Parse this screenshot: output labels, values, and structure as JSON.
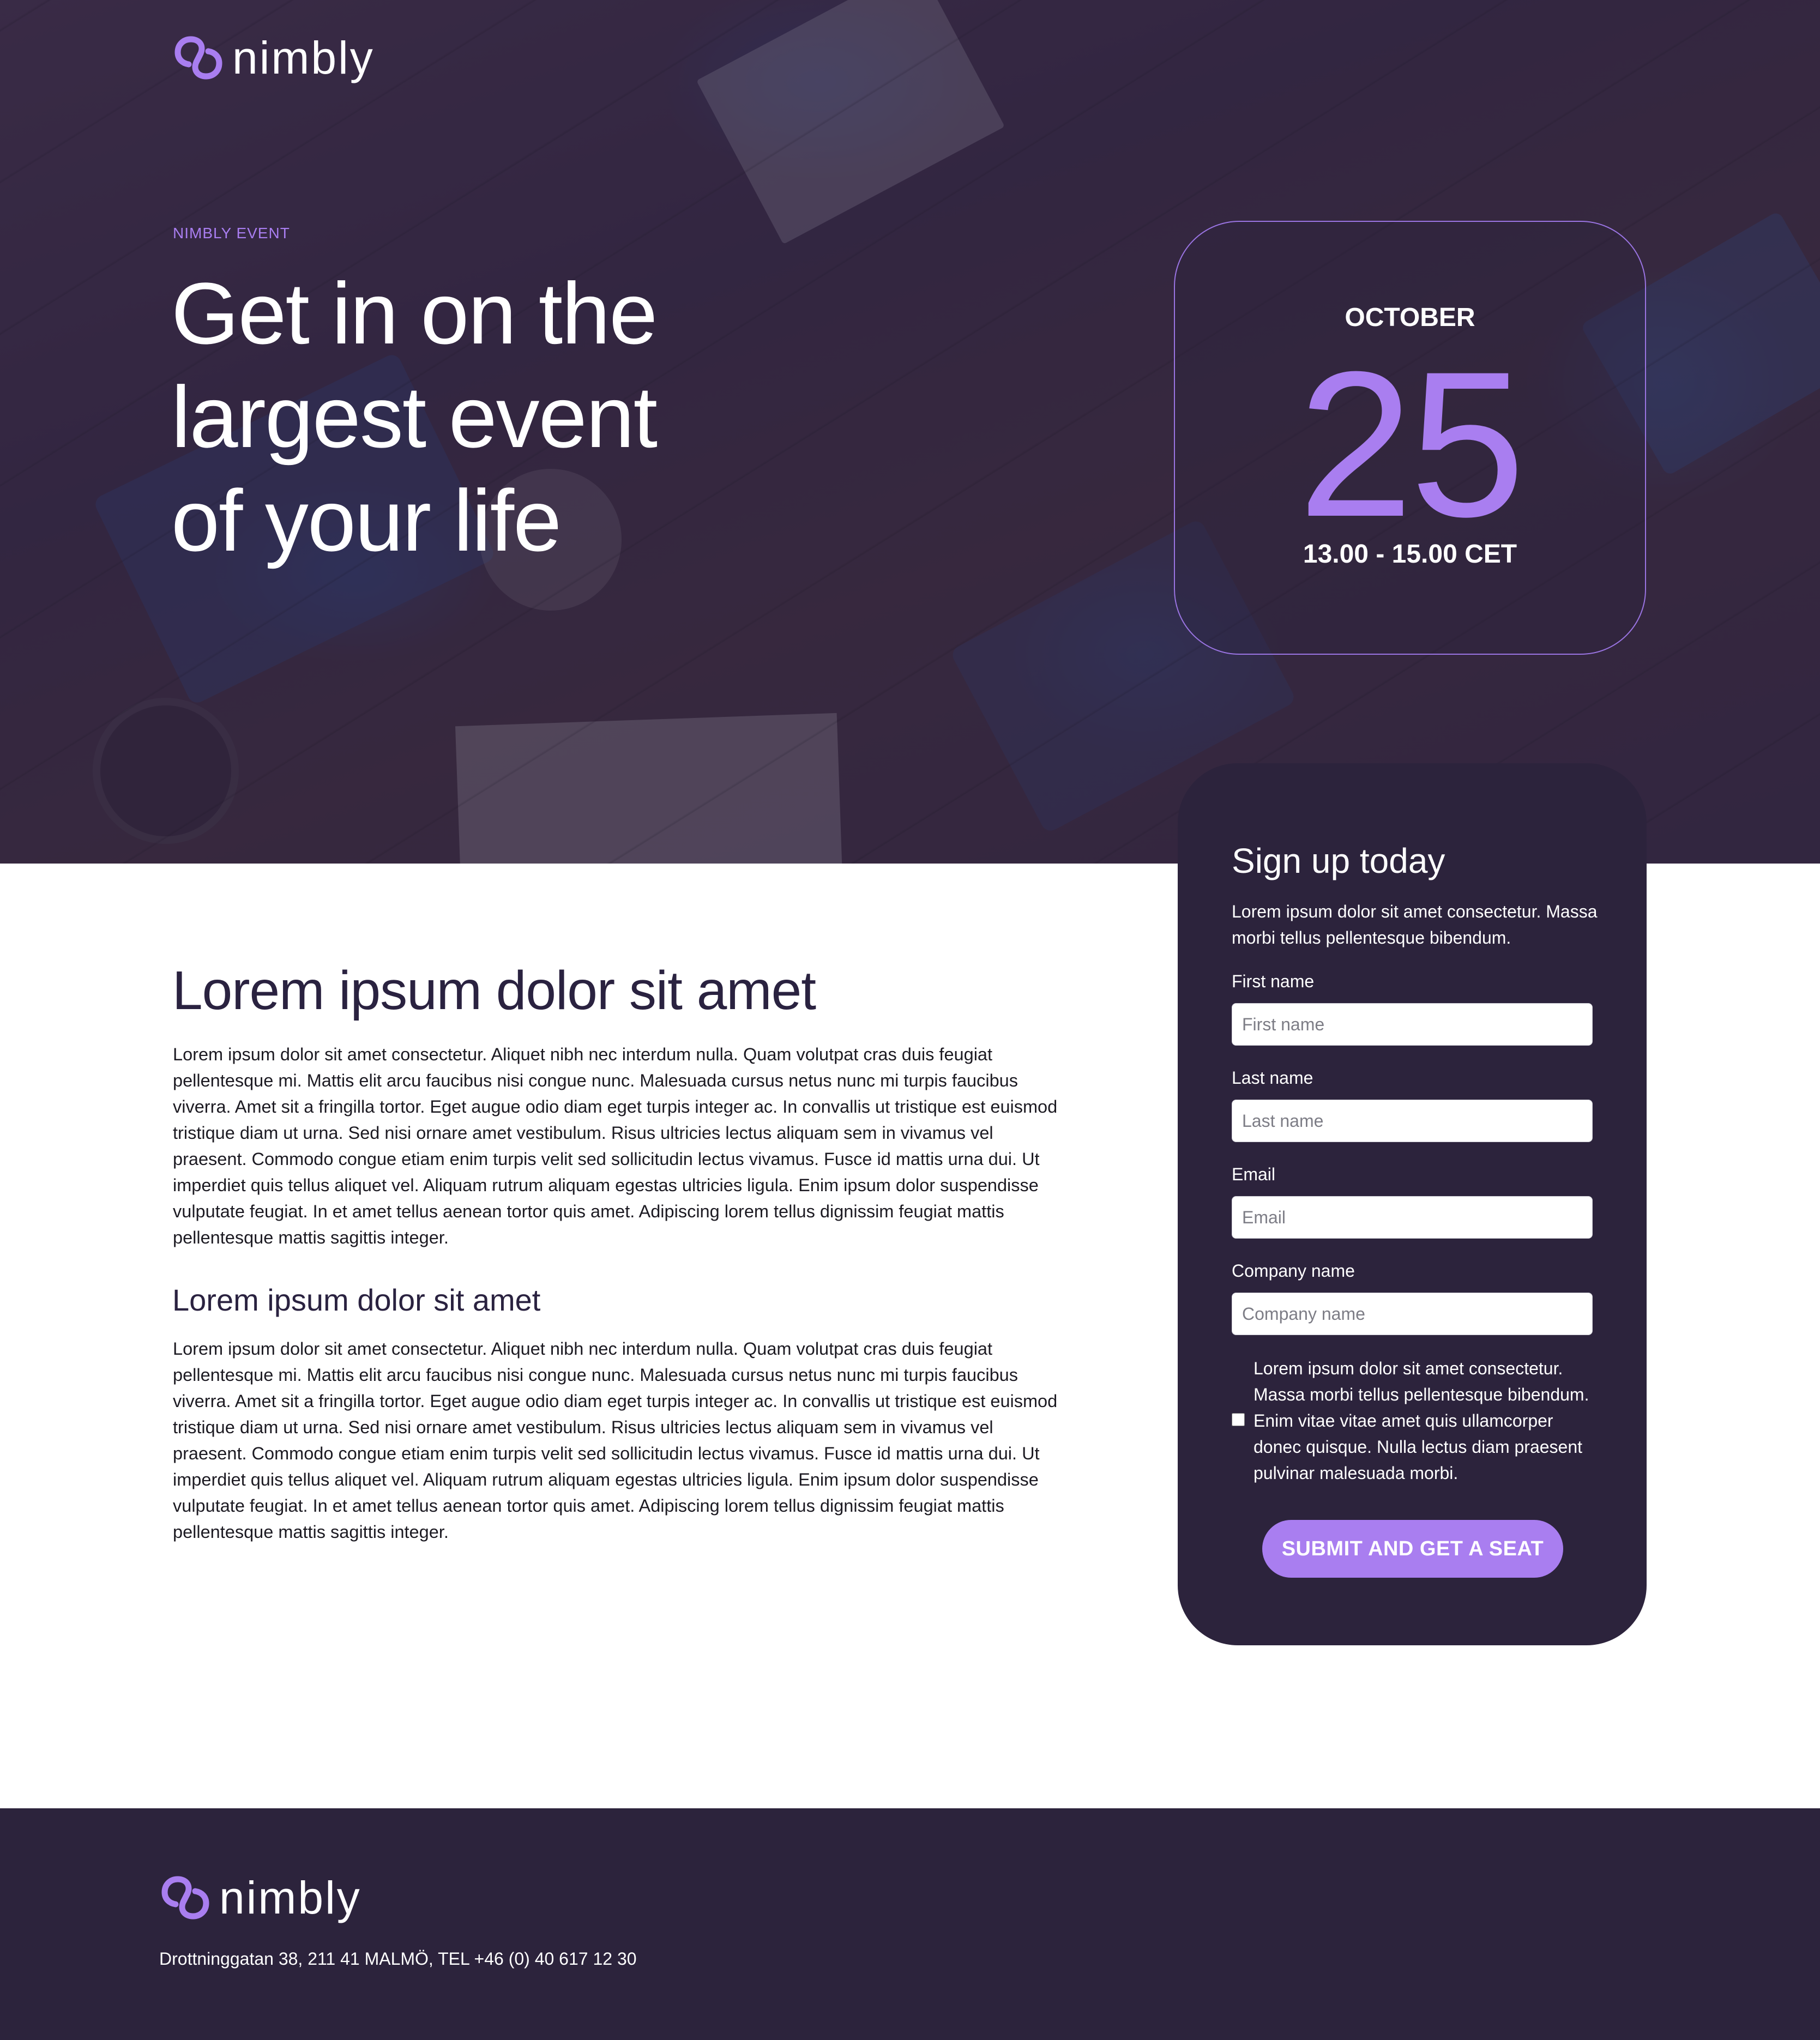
{
  "brand": {
    "name": "nimbly",
    "accent_color": "#a97ef0",
    "dark_color": "#2c233c",
    "logo_icon": "chain-link-icon"
  },
  "hero": {
    "eyebrow": "NIMBLY EVENT",
    "title_lines": [
      "Get in on the",
      "largest event",
      "of your life"
    ]
  },
  "event_date": {
    "month": "OCTOBER",
    "day": "25",
    "time": "13.00 - 15.00 CET"
  },
  "content": {
    "heading": "Lorem ipsum dolor sit amet",
    "paragraph_1": "Lorem ipsum dolor sit amet consectetur. Aliquet nibh nec interdum nulla. Quam volutpat cras duis feugiat pellentesque mi. Mattis elit arcu faucibus nisi congue nunc. Malesuada cursus netus nunc mi turpis faucibus viverra. Amet sit a fringilla tortor. Eget augue odio diam eget turpis integer ac. In convallis ut tristique est euismod tristique diam ut urna. Sed nisi ornare amet vestibulum. Risus ultricies lectus aliquam sem in vivamus vel praesent. Commodo congue etiam enim turpis velit sed sollicitudin lectus vivamus. Fusce id mattis urna dui. Ut imperdiet quis tellus aliquet vel. Aliquam rutrum aliquam egestas ultricies ligula. Enim ipsum dolor suspendisse vulputate feugiat. In et amet tellus aenean tortor quis amet. Adipiscing lorem tellus dignissim feugiat mattis pellentesque mattis sagittis integer.",
    "subheading": "Lorem ipsum dolor sit amet",
    "paragraph_2": "Lorem ipsum dolor sit amet consectetur. Aliquet nibh nec interdum nulla. Quam volutpat cras duis feugiat pellentesque mi. Mattis elit arcu faucibus nisi congue nunc. Malesuada cursus netus nunc mi turpis faucibus viverra. Amet sit a fringilla tortor. Eget augue odio diam eget turpis integer ac. In convallis ut tristique est euismod tristique diam ut urna. Sed nisi ornare amet vestibulum. Risus ultricies lectus aliquam sem in vivamus vel praesent. Commodo congue etiam enim turpis velit sed sollicitudin lectus vivamus. Fusce id mattis urna dui. Ut imperdiet quis tellus aliquet vel. Aliquam rutrum aliquam egestas ultricies ligula. Enim ipsum dolor suspendisse vulputate feugiat. In et amet tellus aenean tortor quis amet. Adipiscing lorem tellus dignissim feugiat mattis pellentesque mattis sagittis integer."
  },
  "signup": {
    "title": "Sign up today",
    "description": "Lorem ipsum dolor sit amet consectetur. Massa morbi tellus pellentesque bibendum.",
    "fields": {
      "first_name": {
        "label": "First name",
        "placeholder": "First name",
        "value": ""
      },
      "last_name": {
        "label": "Last name",
        "placeholder": "Last name",
        "value": ""
      },
      "email": {
        "label": "Email",
        "placeholder": "Email",
        "value": ""
      },
      "company": {
        "label": "Company name",
        "placeholder": "Company name",
        "value": ""
      }
    },
    "consent": {
      "text": "Lorem ipsum dolor sit amet consectetur. Massa morbi tellus pellentesque bibendum. Enim vitae vitae amet quis ullamcorper donec quisque. Nulla lectus diam praesent pulvinar malesuada morbi.",
      "checked": false
    },
    "submit_label": "SUBMIT AND GET A SEAT"
  },
  "footer": {
    "address": "Drottninggatan 38, 211 41 MALMÖ, TEL +46 (0) 40 617 12 30"
  }
}
